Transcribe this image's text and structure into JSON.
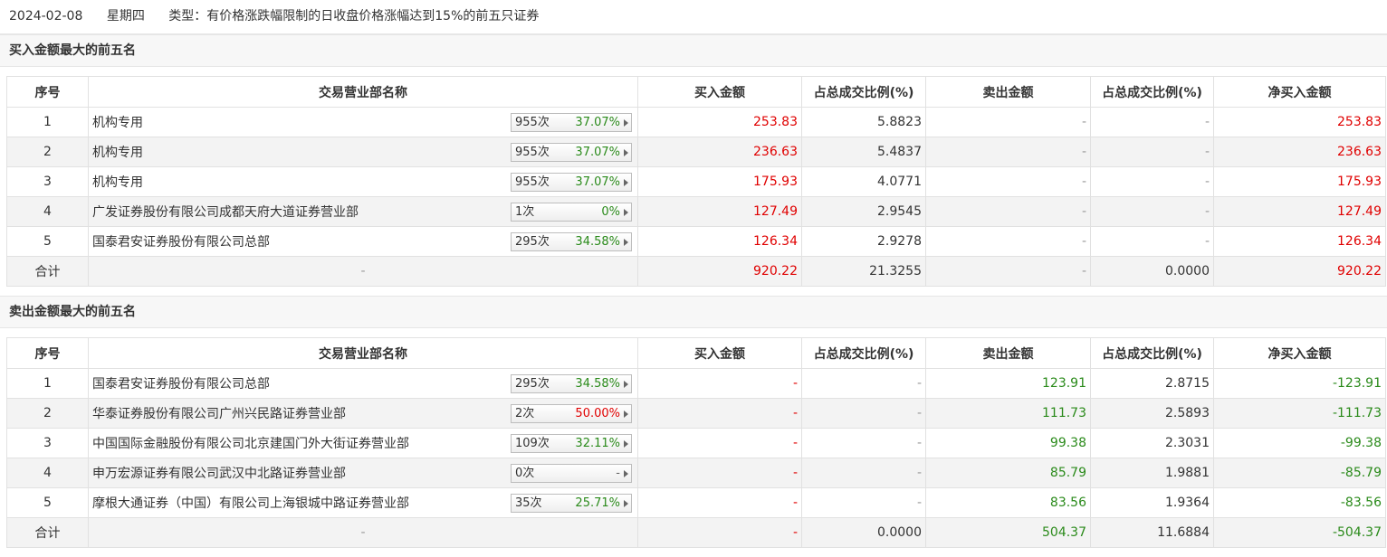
{
  "header": {
    "date": "2024-02-08",
    "weekday": "星期四",
    "type_text": "类型：有价格涨跌幅限制的日收盘价格涨幅达到15%的前五只证券"
  },
  "buy": {
    "title": "买入金额最大的前五名",
    "columns": [
      "序号",
      "交易营业部名称",
      "买入金额",
      "占总成交比例(%)",
      "卖出金额",
      "占总成交比例(%)",
      "净买入金额"
    ],
    "rows": [
      {
        "no": "1",
        "name": "机构专用",
        "times": "955次",
        "pct": "37.07%",
        "pct_color": "green",
        "buy": "253.83",
        "buy_ratio": "5.8823",
        "sell": "-",
        "sell_ratio": "-",
        "net": "253.83"
      },
      {
        "no": "2",
        "name": "机构专用",
        "times": "955次",
        "pct": "37.07%",
        "pct_color": "green",
        "buy": "236.63",
        "buy_ratio": "5.4837",
        "sell": "-",
        "sell_ratio": "-",
        "net": "236.63"
      },
      {
        "no": "3",
        "name": "机构专用",
        "times": "955次",
        "pct": "37.07%",
        "pct_color": "green",
        "buy": "175.93",
        "buy_ratio": "4.0771",
        "sell": "-",
        "sell_ratio": "-",
        "net": "175.93"
      },
      {
        "no": "4",
        "name": "广发证券股份有限公司成都天府大道证券营业部",
        "times": "1次",
        "pct": "0%",
        "pct_color": "green",
        "buy": "127.49",
        "buy_ratio": "2.9545",
        "sell": "-",
        "sell_ratio": "-",
        "net": "127.49"
      },
      {
        "no": "5",
        "name": "国泰君安证券股份有限公司总部",
        "times": "295次",
        "pct": "34.58%",
        "pct_color": "green",
        "buy": "126.34",
        "buy_ratio": "2.9278",
        "sell": "-",
        "sell_ratio": "-",
        "net": "126.34"
      }
    ],
    "total": {
      "label": "合计",
      "name": "-",
      "buy": "920.22",
      "buy_ratio": "21.3255",
      "sell": "-",
      "sell_ratio": "0.0000",
      "net": "920.22"
    }
  },
  "sell": {
    "title": "卖出金额最大的前五名",
    "columns": [
      "序号",
      "交易营业部名称",
      "买入金额",
      "占总成交比例(%)",
      "卖出金额",
      "占总成交比例(%)",
      "净买入金额"
    ],
    "rows": [
      {
        "no": "1",
        "name": "国泰君安证券股份有限公司总部",
        "times": "295次",
        "pct": "34.58%",
        "pct_color": "green",
        "buy": "-",
        "buy_ratio": "-",
        "sell": "123.91",
        "sell_ratio": "2.8715",
        "net": "-123.91"
      },
      {
        "no": "2",
        "name": "华泰证券股份有限公司广州兴民路证券营业部",
        "times": "2次",
        "pct": "50.00%",
        "pct_color": "red",
        "buy": "-",
        "buy_ratio": "-",
        "sell": "111.73",
        "sell_ratio": "2.5893",
        "net": "-111.73"
      },
      {
        "no": "3",
        "name": "中国国际金融股份有限公司北京建国门外大街证券营业部",
        "times": "109次",
        "pct": "32.11%",
        "pct_color": "green",
        "buy": "-",
        "buy_ratio": "-",
        "sell": "99.38",
        "sell_ratio": "2.3031",
        "net": "-99.38"
      },
      {
        "no": "4",
        "name": "申万宏源证券有限公司武汉中北路证券营业部",
        "times": "0次",
        "pct": "-",
        "pct_color": "gray",
        "buy": "-",
        "buy_ratio": "-",
        "sell": "85.79",
        "sell_ratio": "1.9881",
        "net": "-85.79"
      },
      {
        "no": "5",
        "name": "摩根大通证券（中国）有限公司上海银城中路证券营业部",
        "times": "35次",
        "pct": "25.71%",
        "pct_color": "green",
        "buy": "-",
        "buy_ratio": "-",
        "sell": "83.56",
        "sell_ratio": "1.9364",
        "net": "-83.56"
      }
    ],
    "total": {
      "label": "合计",
      "name": "-",
      "buy": "-",
      "buy_ratio": "0.0000",
      "sell": "504.37",
      "sell_ratio": "11.6884",
      "net": "-504.37"
    }
  },
  "colors": {
    "red": "#e00000",
    "green": "#2a8a1a",
    "gray": "#666666"
  },
  "icons": {
    "expand": "caret-right-icon"
  }
}
